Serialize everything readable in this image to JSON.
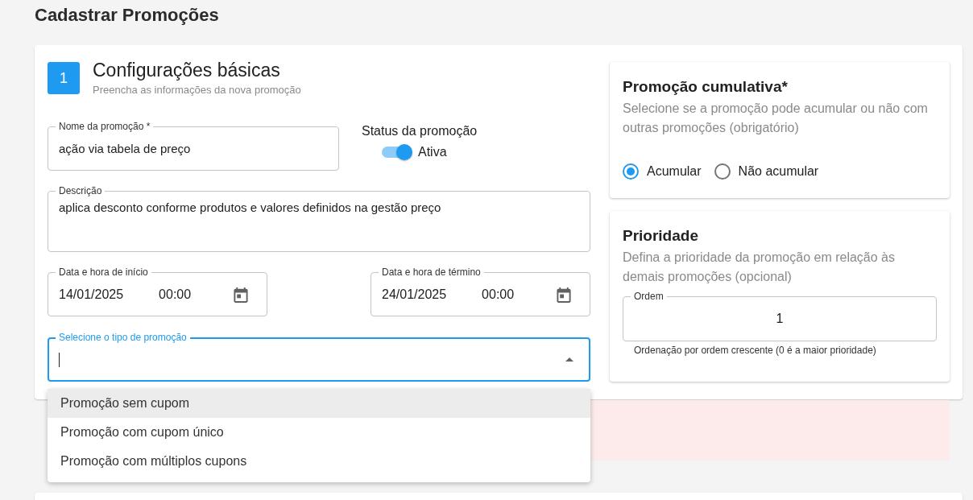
{
  "page_title": "Cadastrar Promoções",
  "basic": {
    "step": "1",
    "title": "Configurações básicas",
    "subtitle": "Preencha as informações da nova promoção",
    "name_field": {
      "label": "Nome da promoção *",
      "value": "ação via tabela de preço"
    },
    "status": {
      "label": "Status da promoção",
      "on": true,
      "text": "Ativa"
    },
    "description_field": {
      "label": "Descrição",
      "value": "aplica desconto conforme produtos e valores definidos na gestão preço"
    },
    "start_field": {
      "label": "Data e hora de início",
      "date": "14/01/2025",
      "time": "00:00"
    },
    "end_field": {
      "label": "Data e hora de término",
      "date": "24/01/2025",
      "time": "00:00"
    },
    "type_select": {
      "label": "Selecione o tipo de promoção",
      "focused": true,
      "expanded": true,
      "options": [
        {
          "label": "Promoção sem cupom",
          "selected": true
        },
        {
          "label": "Promoção com cupom único",
          "selected": false
        },
        {
          "label": "Promoção com múltiplos cupons",
          "selected": false
        }
      ]
    }
  },
  "cumulative": {
    "title": "Promoção cumulativa*",
    "description": "Selecione se a promoção pode acumular ou não com outras promoções (obrigatório)",
    "options": [
      {
        "label": "Acumular",
        "selected": true
      },
      {
        "label": "Não acumular",
        "selected": false
      }
    ]
  },
  "priority": {
    "title": "Prioridade",
    "description": "Defina a prioridade da promoção em relação às demais promoções (opcional)",
    "order_field": {
      "label": "Ordem",
      "value": "1",
      "helper": "Ordenação por ordem crescente (0 é a maior prioridade)"
    }
  }
}
